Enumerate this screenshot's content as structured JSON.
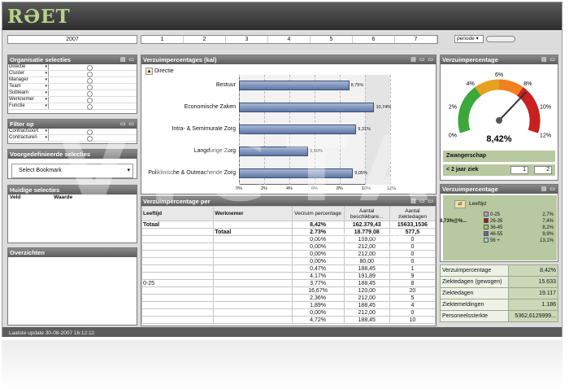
{
  "app": {
    "logo": "RƏET",
    "last_update": "Laatste update 30-08-2007 16:12:12"
  },
  "filters": {
    "year": "2007",
    "months": [
      "1",
      "2",
      "3",
      "4",
      "5",
      "6",
      "7"
    ],
    "periode": "periode"
  },
  "org_panel": {
    "title": "Organisatie selecties",
    "fields": [
      "Directie",
      "Cluster",
      "Manager",
      "Team",
      "Subteam",
      "Werknemer",
      "Functie"
    ]
  },
  "filter_panel": {
    "title": "Filter op",
    "fields": [
      "Contractsoort",
      "Contracturen"
    ]
  },
  "bookmark_panel": {
    "title": "Voorgedefinieerde selecties",
    "value": "Select Bookmark"
  },
  "current_panel": {
    "title": "Huidige selecties",
    "col1": "Veld",
    "col2": "Waarde"
  },
  "overview_panel": {
    "title": "Overzichten"
  },
  "bar_panel": {
    "title": "Verzuimpercentages (kal)",
    "crumb": "Directie"
  },
  "chart_data": {
    "type": "bar",
    "orientation": "horizontal",
    "categories": [
      "Bestuur",
      "Economische Zaken",
      "Intra- & Semimurale Zorg",
      "Langdurige Zorg",
      "Poliklinische & Outreachende Zorg"
    ],
    "values": [
      8.75,
      10.74,
      9.31,
      5.5,
      9.05
    ],
    "value_labels": [
      "8,75%",
      "10,74%",
      "9,31%",
      "5,50%",
      "9,05%"
    ],
    "xlim": [
      0,
      12
    ],
    "xticks": [
      "0%",
      "2%",
      "4%",
      "6%",
      "8%",
      "10%",
      "12%"
    ]
  },
  "pivot": {
    "title": "Verzuimpercentage per",
    "headers": [
      "Leeftijd",
      "Werknemer",
      "Verzuim percentage",
      "Aantal beschikbare...",
      "Aantal ziektedagen"
    ],
    "total_row": [
      "Totaal",
      "",
      "8,42%",
      "162.379,43",
      "15633,1536"
    ],
    "sub_total": [
      "",
      "Totaal",
      "2,73%",
      "18.779,08",
      "577,5"
    ],
    "age_group": "0-25",
    "rows": [
      [
        "0,00%",
        "159,00",
        "0"
      ],
      [
        "0,00%",
        "212,00",
        "0"
      ],
      [
        "0,00%",
        "212,00",
        "0"
      ],
      [
        "0,00%",
        "80,00",
        "0"
      ],
      [
        "0,47%",
        "188,45",
        "1"
      ],
      [
        "4,17%",
        "191,89",
        "9"
      ],
      [
        "3,77%",
        "188,45",
        "8"
      ],
      [
        "16,67%",
        "120,00",
        "20"
      ],
      [
        "2,36%",
        "212,00",
        "5"
      ],
      [
        "1,89%",
        "188,45",
        "4"
      ],
      [
        "0,00%",
        "212,00",
        "0"
      ],
      [
        "4,72%",
        "188,45",
        "10"
      ]
    ]
  },
  "gauge_panel": {
    "title": "Verzuimpercentage",
    "value": "8,42%",
    "labels": [
      "0%",
      "2%",
      "4%",
      "6%",
      "8%",
      "10%",
      "12%"
    ],
    "zwanger": "Zwangerschap",
    "lt2": "< 2 jaar ziek",
    "lt2_from": "1",
    "lt2_to": "2"
  },
  "age_panel": {
    "title": "Verzuimpercentage",
    "legend_title": "Leeftijd",
    "first_value": "8,73%@%...",
    "groups": [
      {
        "label": "0-25",
        "value": "2,7%",
        "color": "#b0a0d8"
      },
      {
        "label": "26-35",
        "value": "7,4%",
        "color": "#a01818"
      },
      {
        "label": "36-45",
        "value": "8,2%",
        "color": "#a8c868"
      },
      {
        "label": "46-55",
        "value": "9,9%",
        "color": "#7a5aa8"
      },
      {
        "label": "56 +",
        "value": "13,1%",
        "color": "#9ad0e8"
      }
    ]
  },
  "kpis": [
    {
      "label": "Verzuimpercentage",
      "value": "8,42%"
    },
    {
      "label": "Ziektedagen (gewogen)",
      "value": "15.633"
    },
    {
      "label": "Ziektedagen",
      "value": "19.117"
    },
    {
      "label": "Ziektemeldingen",
      "value": "1.186"
    },
    {
      "label": "Personeelssterkte",
      "value": "5362,6129999..."
    }
  ],
  "watermark": {
    "big": "VICTA",
    "small": "ADD VALUE AND MORE"
  }
}
